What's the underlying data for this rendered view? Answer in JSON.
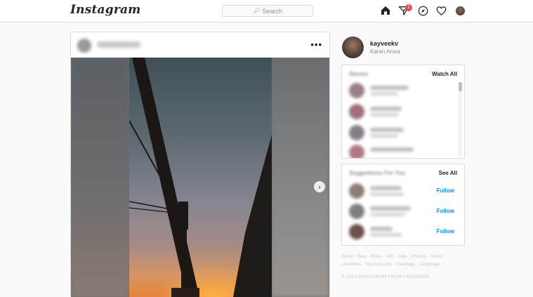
{
  "app": {
    "logo": "Instagram"
  },
  "search": {
    "placeholder": "Search"
  },
  "nav": {
    "icons": [
      "home-icon",
      "direct-icon",
      "explore-icon",
      "activity-icon",
      "profile-avatar"
    ],
    "direct_badge": "1"
  },
  "post": {
    "more_label": "•••",
    "next_label": "›"
  },
  "profile": {
    "username": "kayveekv",
    "full_name": "Karan Arora"
  },
  "stories": {
    "title": "Stories",
    "action": "Watch All",
    "items": [
      {
        "avatar_color": "#9a7f86"
      },
      {
        "avatar_color": "#a0707a"
      },
      {
        "avatar_color": "#877f88"
      },
      {
        "avatar_color": "#b07a80"
      }
    ]
  },
  "suggestions": {
    "title": "Suggestions For You",
    "action": "See All",
    "items": [
      {
        "follow_label": "Follow",
        "avatar_color": "#8f7a76"
      },
      {
        "follow_label": "Follow",
        "avatar_color": "#7e7e7e"
      },
      {
        "follow_label": "Follow",
        "avatar_color": "#6d5149"
      }
    ]
  },
  "footer": {
    "links_line1": "About · Help · Press · API · Jobs · Privacy · Terms ·",
    "links_line2": "Locations · Top Accounts · Hashtags · Language",
    "copyright": "© 2020 INSTAGRAM FROM FACEBOOK"
  },
  "colors": {
    "accent": "#0095f6",
    "badge": "#ed4956",
    "border": "#dbdbdb",
    "background": "#fafafa"
  }
}
